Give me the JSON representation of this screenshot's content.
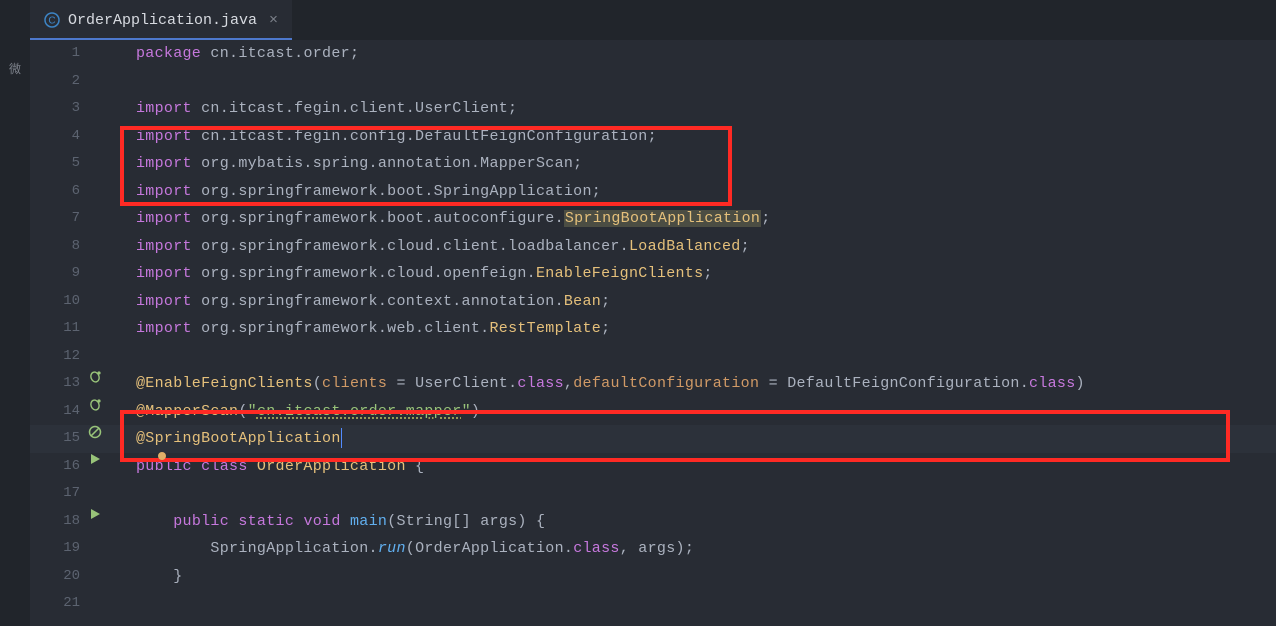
{
  "leftStrip": {
    "label": "微"
  },
  "tab": {
    "filename": "OrderApplication.java"
  },
  "lines": [
    {
      "n": 1,
      "gutter": null,
      "tokens": [
        [
          "kw",
          "package"
        ],
        [
          "pkg",
          " cn.itcast.order;"
        ]
      ]
    },
    {
      "n": 2,
      "gutter": null,
      "tokens": []
    },
    {
      "n": 3,
      "gutter": null,
      "tokens": [
        [
          "kw",
          "import"
        ],
        [
          "pkg",
          " cn.itcast.fegin.client.UserClient;"
        ]
      ]
    },
    {
      "n": 4,
      "gutter": null,
      "tokens": [
        [
          "kw",
          "import"
        ],
        [
          "pkg",
          " cn.itcast.fegin.config.DefaultFeignConfiguration;"
        ]
      ]
    },
    {
      "n": 5,
      "gutter": null,
      "tokens": [
        [
          "kw",
          "import"
        ],
        [
          "pkg",
          " org.mybatis.spring.annotation.MapperScan;"
        ]
      ]
    },
    {
      "n": 6,
      "gutter": null,
      "tokens": [
        [
          "kw",
          "import"
        ],
        [
          "pkg",
          " org.springframework.boot.SpringApplication;"
        ]
      ]
    },
    {
      "n": 7,
      "gutter": null,
      "tokens": [
        [
          "kw",
          "import"
        ],
        [
          "pkg",
          " org.springframework.boot.autoconfigure."
        ],
        [
          "cls hl-box",
          "SpringBootApplication"
        ],
        [
          "pkg",
          ";"
        ]
      ]
    },
    {
      "n": 8,
      "gutter": null,
      "tokens": [
        [
          "kw",
          "import"
        ],
        [
          "pkg",
          " org.springframework.cloud.client.loadbalancer."
        ],
        [
          "cls",
          "LoadBalanced"
        ],
        [
          "pkg",
          ";"
        ]
      ]
    },
    {
      "n": 9,
      "gutter": null,
      "tokens": [
        [
          "kw",
          "import"
        ],
        [
          "pkg",
          " org.springframework.cloud.openfeign."
        ],
        [
          "cls",
          "EnableFeignClients"
        ],
        [
          "pkg",
          ";"
        ]
      ]
    },
    {
      "n": 10,
      "gutter": null,
      "tokens": [
        [
          "kw",
          "import"
        ],
        [
          "pkg",
          " org.springframework.context.annotation."
        ],
        [
          "cls",
          "Bean"
        ],
        [
          "pkg",
          ";"
        ]
      ]
    },
    {
      "n": 11,
      "gutter": null,
      "tokens": [
        [
          "kw",
          "import"
        ],
        [
          "pkg",
          " org.springframework.web.client."
        ],
        [
          "cls",
          "RestTemplate"
        ],
        [
          "pkg",
          ";"
        ]
      ]
    },
    {
      "n": 12,
      "gutter": null,
      "tokens": []
    },
    {
      "n": 13,
      "gutter": "bean",
      "tokens": [
        [
          "ann",
          "@EnableFeignClients"
        ],
        [
          "op",
          "("
        ],
        [
          "param",
          "clients "
        ],
        [
          "op",
          "= "
        ],
        [
          "pkg",
          "UserClient."
        ],
        [
          "kw",
          "class"
        ],
        [
          "op",
          ","
        ],
        [
          "param",
          "defaultConfiguration "
        ],
        [
          "op",
          "= "
        ],
        [
          "pkg",
          "DefaultFeignConfiguration."
        ],
        [
          "kw",
          "class"
        ],
        [
          "op",
          ")"
        ]
      ]
    },
    {
      "n": 14,
      "gutter": "bean",
      "tokens": [
        [
          "ann",
          "@MapperScan"
        ],
        [
          "op",
          "("
        ],
        [
          "str",
          "\""
        ],
        [
          "str underline-wavy",
          "cn.itcast.order.mapper"
        ],
        [
          "str",
          "\""
        ],
        [
          "op",
          ")"
        ]
      ]
    },
    {
      "n": 15,
      "gutter": "forbid",
      "current": true,
      "tokens": [
        [
          "ann",
          "@SpringBootApplication"
        ]
      ],
      "cursor": true
    },
    {
      "n": 16,
      "gutter": "run",
      "tokens": [
        [
          "kw",
          "public class "
        ],
        [
          "cls",
          "OrderApplication "
        ],
        [
          "op",
          "{"
        ]
      ]
    },
    {
      "n": 17,
      "gutter": null,
      "tokens": []
    },
    {
      "n": 18,
      "gutter": "run",
      "tokens": [
        [
          "pkg",
          "    "
        ],
        [
          "kw",
          "public static "
        ],
        [
          "kw",
          "void "
        ],
        [
          "fn",
          "main"
        ],
        [
          "op",
          "("
        ],
        [
          "pkg",
          "String[] args"
        ],
        [
          "op",
          ") {"
        ]
      ]
    },
    {
      "n": 19,
      "gutter": null,
      "tokens": [
        [
          "pkg",
          "        SpringApplication."
        ],
        [
          "fn italic",
          "run"
        ],
        [
          "op",
          "("
        ],
        [
          "pkg",
          "OrderApplication."
        ],
        [
          "kw",
          "class"
        ],
        [
          "op",
          ", args);"
        ]
      ]
    },
    {
      "n": 20,
      "gutter": null,
      "tokens": [
        [
          "op",
          "    }"
        ]
      ]
    },
    {
      "n": 21,
      "gutter": null,
      "tokens": []
    }
  ]
}
